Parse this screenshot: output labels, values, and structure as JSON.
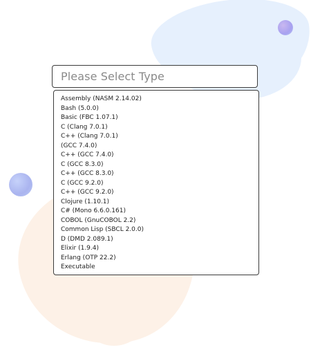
{
  "select": {
    "placeholder": "Please Select Type"
  },
  "options": [
    "Assembly (NASM 2.14.02)",
    "Bash (5.0.0)",
    "Basic (FBC 1.07.1)",
    "C (Clang 7.0.1)",
    "C++ (Clang 7.0.1)",
    "(GCC 7.4.0)",
    "C++ (GCC 7.4.0)",
    "C (GCC 8.3.0)",
    "C++ (GCC 8.3.0)",
    "C (GCC 9.2.0)",
    "C++ (GCC 9.2.0)",
    "Clojure (1.10.1)",
    "C# (Mono 6.6.0.161)",
    "COBOL (GnuCOBOL 2.2)",
    "Common Lisp (SBCL 2.0.0)",
    "D (DMD 2.089.1)",
    "Elixir (1.9.4)",
    "Erlang (OTP 22.2)",
    "Executable"
  ],
  "colors": {
    "border": "#3b3b3b",
    "placeholder": "#8a8a8a",
    "blob_blue": "#e6f0fd",
    "blob_peach": "#fdf1e7",
    "dot_purple": "#a8a1f0",
    "dot_lilac": "#aab4ef"
  }
}
